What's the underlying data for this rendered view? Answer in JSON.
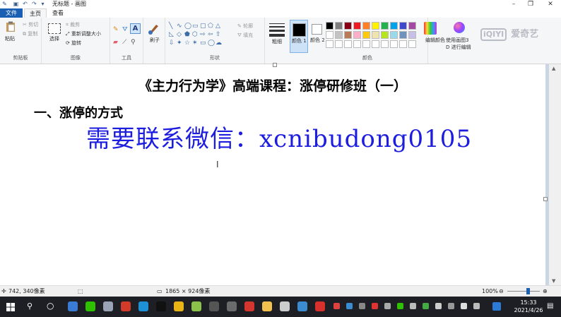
{
  "window": {
    "title": "无标题 - 画图",
    "controls": [
      "–",
      "❐",
      "✕"
    ]
  },
  "menu": {
    "tabs": [
      "文件",
      "主页",
      "查看"
    ]
  },
  "ribbon": {
    "clipboard": {
      "paste": "粘贴",
      "cut": "剪切",
      "copy": "复制",
      "label": "剪贴板"
    },
    "image": {
      "select": "选择",
      "crop": "裁剪",
      "resize": "重新调整大小",
      "rotate": "旋转",
      "label": "图像"
    },
    "tools": {
      "label": "工具"
    },
    "brush": {
      "label": "刷子"
    },
    "shapes": {
      "outline": "轮廓",
      "fill": "填充",
      "label": "形状"
    },
    "size": {
      "label": "粗细"
    },
    "colors": {
      "color1": "颜色 1",
      "color2": "颜色 2",
      "edit": "编辑颜色",
      "label": "颜色",
      "row1": [
        "#000000",
        "#7f7f7f",
        "#880015",
        "#ed1c24",
        "#ff7f27",
        "#fff200",
        "#22b14c",
        "#00a2e8",
        "#3f48cc",
        "#a349a4"
      ],
      "row2": [
        "#ffffff",
        "#c3c3c3",
        "#b97a57",
        "#ffaec9",
        "#ffc90e",
        "#efe4b0",
        "#b5e61d",
        "#99d9ea",
        "#7092be",
        "#c8bfe7"
      ],
      "row3": [
        "#ffffff",
        "#ffffff",
        "#ffffff",
        "#ffffff",
        "#ffffff",
        "#ffffff",
        "#ffffff",
        "#ffffff",
        "#ffffff",
        "#ffffff"
      ]
    },
    "paint3d": {
      "line1": "使用画图3",
      "line2": "D 进行编辑"
    }
  },
  "watermark": "爱奇艺",
  "canvas": {
    "title": "《主力行为学》高端课程：涨停研修班（一）",
    "section": "一、涨停的方式",
    "overlay": "需要联系微信：xcnibudong0105"
  },
  "status": {
    "cursor_pos": "742, 340像素",
    "image_size": "1865 × 924像素",
    "zoom": "100%"
  },
  "taskbar": {
    "time": "15:33",
    "date": "2021/4/26",
    "apps": [
      {
        "name": "browser-app",
        "color": "#3a7bd5"
      },
      {
        "name": "wechat-app",
        "color": "#2dc100"
      },
      {
        "name": "circle-app",
        "color": "#9aa3b5"
      },
      {
        "name": "media-app",
        "color": "#d23b2a"
      },
      {
        "name": "edge-app",
        "color": "#1e90d6"
      },
      {
        "name": "qq-app",
        "color": "#111111"
      },
      {
        "name": "chrome-app",
        "color": "#e8b416"
      },
      {
        "name": "green-app",
        "color": "#8bc34a"
      },
      {
        "name": "obs-app",
        "color": "#555555"
      },
      {
        "name": "movie-app",
        "color": "#6b6b6b"
      },
      {
        "name": "red-app",
        "color": "#d3362e"
      },
      {
        "name": "folder-app",
        "color": "#f2c14e"
      },
      {
        "name": "pet-app",
        "color": "#cccccc"
      },
      {
        "name": "search-app",
        "color": "#3b8bd0"
      },
      {
        "name": "wps-app",
        "color": "#d8302c"
      }
    ]
  }
}
